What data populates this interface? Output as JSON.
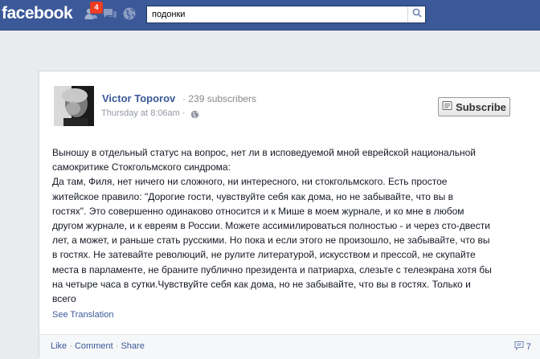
{
  "topbar": {
    "logo": "facebook",
    "friend_requests_badge": "4",
    "search": {
      "value": "подонки",
      "placeholder": ""
    }
  },
  "post": {
    "author": "Victor Toporov",
    "separator": "·",
    "subscribers": "239 subscribers",
    "timestamp": "Thursday at 8:06am",
    "audience_separator": "·",
    "subscribe_label": "Subscribe",
    "text": "Выношу в отдельный статус на вопрос, нет ли в исповедуемой мной еврейской национальной\nсамокритике Стокгольмского синдрома:\nДа там, Филя, нет ничего ни сложного, ни интересного, ни стокгольмского. Есть простое\nжитейское правило: \"Дорогие гости, чувствуйте себя как дома, но не забывайте, что вы в\nгостях\". Это совершенно одинаково относится и к Мише в моем журнале, и ко мне в любом\nдругом журнале, и к евреям в России. Можете ассимилироваться полностью - и через сто-двести\nлет, а может, и раньше стать русскими. Но пока и если этого не произошло, не забывайте, что вы\nв гостях. Не затевайте революций, не рулите литературой, искусством и прессой, не скупайте\nместа в парламенте, не браните публично президента и патриарха, слезьте с телеэкрана хотя бы\nна четыре часа в сутки.Чувствуйте себя как дома, но не забывайте, что вы в гостях. Только и\nвсего",
    "see_translation": "See Translation",
    "actions": {
      "like": "Like",
      "comment": "Comment",
      "share": "Share",
      "dot": "·"
    },
    "comment_count": "7"
  }
}
